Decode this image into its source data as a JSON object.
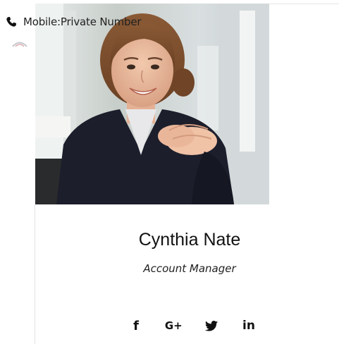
{
  "contact": {
    "phone_label": "Mobile:Private Number",
    "phone_icon": "phone-icon"
  },
  "profile": {
    "name": "Cynthia Nate",
    "title": "Account Manager",
    "photo": "portrait-photo"
  },
  "social": [
    {
      "name": "facebook-icon",
      "glyph": "f"
    },
    {
      "name": "google-plus-icon",
      "glyph": "G+"
    },
    {
      "name": "twitter-icon",
      "glyph": "twitter-bird"
    },
    {
      "name": "linkedin-icon",
      "glyph": "in"
    }
  ],
  "colors": {
    "text": "#111111",
    "divider": "#e2e2e2",
    "jacket": "#1c1e2b",
    "background_photo": "#cfd6d7"
  }
}
